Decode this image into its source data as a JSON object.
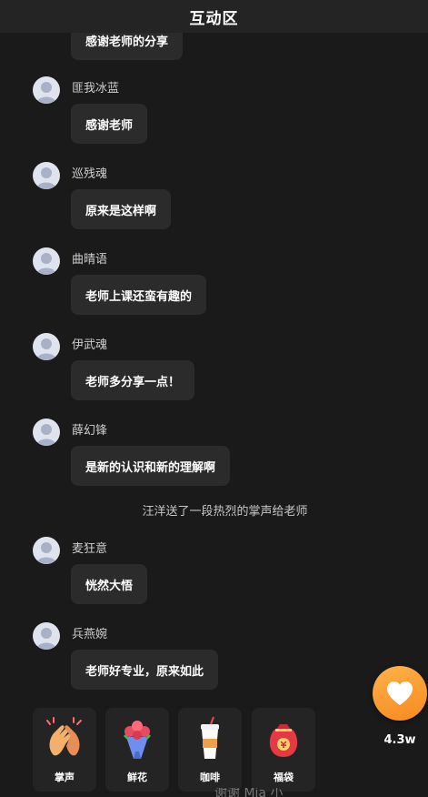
{
  "header": {
    "title": "互动区"
  },
  "messages": [
    {
      "user": "",
      "text": "感谢老师的分享"
    },
    {
      "user": "匪我冰蓝",
      "text": "感谢老师"
    },
    {
      "user": "巡残魂",
      "text": "原来是这样啊"
    },
    {
      "user": "曲晴语",
      "text": "老师上课还蛮有趣的"
    },
    {
      "user": "伊武魂",
      "text": "老师多分享一点！"
    },
    {
      "user": "薛幻锋",
      "text": "是新的认识和新的理解啊"
    },
    {
      "user": "麦狂意",
      "text": "恍然大悟"
    },
    {
      "user": "兵燕婉",
      "text": "老师好专业，原来如此"
    }
  ],
  "system_message": "汪洋送了一段热烈的掌声给老师",
  "like": {
    "count": "4.3w",
    "icon": "heart-icon"
  },
  "gifts": [
    {
      "label": "掌声",
      "icon": "clapping-hands-icon"
    },
    {
      "label": "鲜花",
      "icon": "flower-bouquet-icon"
    },
    {
      "label": "咖啡",
      "icon": "coffee-cup-icon"
    },
    {
      "label": "福袋",
      "icon": "lucky-bag-icon"
    }
  ],
  "bottom_partial_text": "谢谢 Mia 小"
}
